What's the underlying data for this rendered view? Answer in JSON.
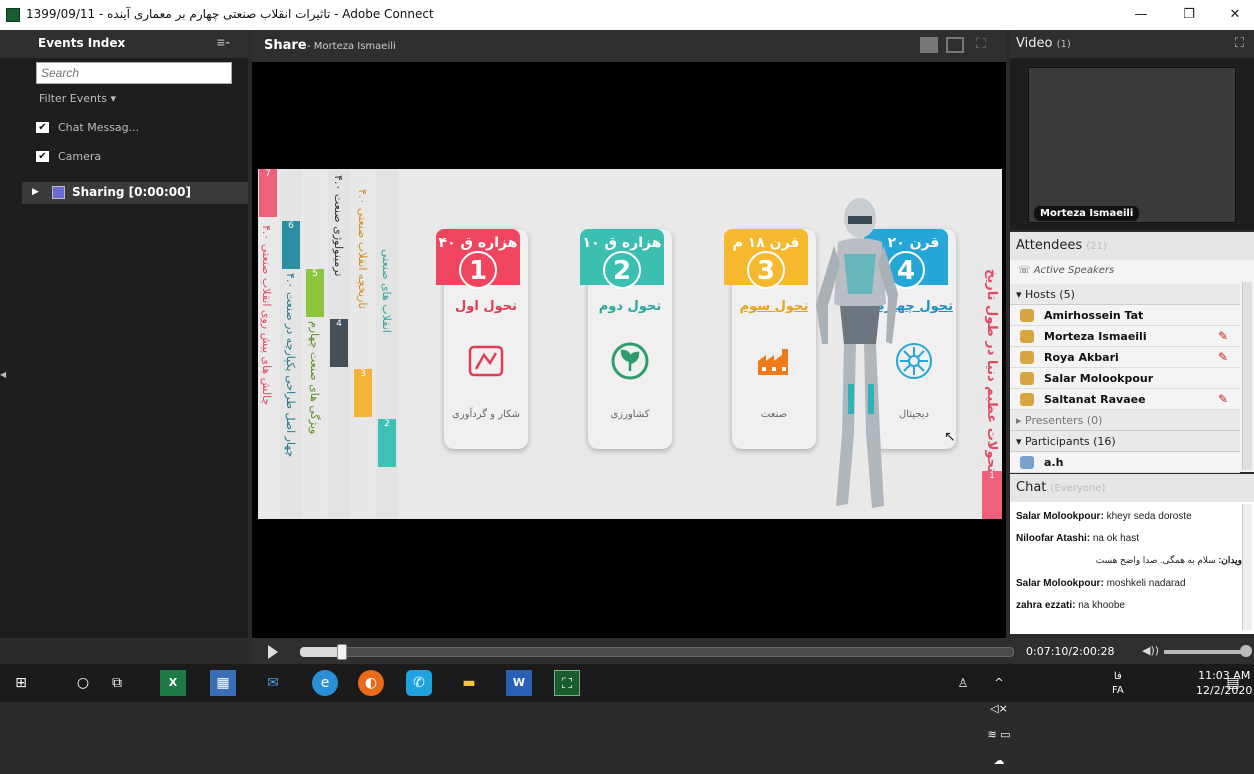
{
  "window": {
    "title": "1399/09/11 - تاثیرات انقلاب صنعتی چهارم بر معماری آینده - Adobe Connect",
    "minimize": "—",
    "maximize": "❐",
    "close": "✕"
  },
  "events_index": {
    "title": "Events Index",
    "menu": "≡-",
    "search_placeholder": "Search",
    "filter_label": "Filter Events ▾",
    "filters": [
      {
        "label": "Chat Messag...",
        "checked": true
      },
      {
        "label": "Camera",
        "checked": true
      }
    ],
    "sharing_item": "Sharing [0:00:00]"
  },
  "share": {
    "title": "Share",
    "presenter": "- Morteza Ismaeili",
    "slide": {
      "side_title": "تحولات عظیم دنیا در طول تاریخ",
      "strips": [
        {
          "num": "7",
          "text": "چالش های پیش روی انقلاب صنعتی ۴.۰",
          "color": "#f0607a"
        },
        {
          "num": "6",
          "text": "چهار اصل طراحی یکپارچه در صنعت ۴.۰",
          "color": "#2a8fa0"
        },
        {
          "num": "5",
          "text": "ویژگی های صنعت چهارم",
          "color": "#8cc63f"
        },
        {
          "num": "4",
          "text": "ترمینولوژی صنعت ۴.۰",
          "color": "#444f58"
        },
        {
          "num": "3",
          "text": "تاریخچه انقلاب صنعتی ۴.۰",
          "color": "#f4b33a"
        },
        {
          "num": "2",
          "text": "انقلاب های صنعتی",
          "color": "#3ec1b6"
        }
      ],
      "right_tag": "1",
      "cards": [
        {
          "era": "۴۰ هزاره ق",
          "num": "1",
          "title": "تحول اول",
          "foot": "شکار و گردآوری",
          "color": "#f0455e"
        },
        {
          "era": "۱۰ هزاره ق",
          "num": "2",
          "title": "تحول دوم",
          "foot": "کشاورزی",
          "color": "#3bbfb1"
        },
        {
          "era": "قرن ۱۸ م",
          "num": "3",
          "title": "تحول سوم",
          "foot": "صنعت",
          "color": "#f5b82e"
        },
        {
          "era": "قرن ۲۰ م",
          "num": "4",
          "title": "تحول چهارم",
          "foot": "دیجیتال",
          "color": "#25a6d9"
        }
      ]
    }
  },
  "video": {
    "title": "Video",
    "count": "(1)",
    "speaker": "Morteza Ismaeili"
  },
  "attendees": {
    "title": "Attendees",
    "count": "(21)",
    "active_speakers": "Active Speakers",
    "hosts_label": "Hosts (5)",
    "hosts": [
      {
        "name": "Amirhossein Tat",
        "muted": false
      },
      {
        "name": "Morteza Ismaeili",
        "muted": true
      },
      {
        "name": "Roya Akbari",
        "muted": true
      },
      {
        "name": "Salar Molookpour",
        "muted": false
      },
      {
        "name": "Saltanat Ravaee",
        "muted": true
      }
    ],
    "presenters_label": "Presenters (0)",
    "participants_label": "Participants (16)",
    "participants": [
      {
        "name": "a.h"
      }
    ]
  },
  "chat": {
    "title": "Chat",
    "scope": "(Everyone)",
    "messages": [
      {
        "from": "Salar Molookpour:",
        "text": " kheyr seda doroste"
      },
      {
        "from": "Niloofar Atashi:",
        "text": " na ok hast"
      },
      {
        "from": "ویدان:",
        "text": "سلام به همگی. صدا واضح هست"
      },
      {
        "from": "Salar Molookpour:",
        "text": " moshkeli nadarad"
      },
      {
        "from": "zahra ezzati:",
        "text": "  na khoobe"
      }
    ]
  },
  "playback": {
    "time": "0:07:10/2:00:28",
    "progress": 0.0595
  },
  "taskbar": {
    "time": "11:03 AM",
    "date": "12/2/2020",
    "lang": "FA",
    "lang2": "فا"
  }
}
